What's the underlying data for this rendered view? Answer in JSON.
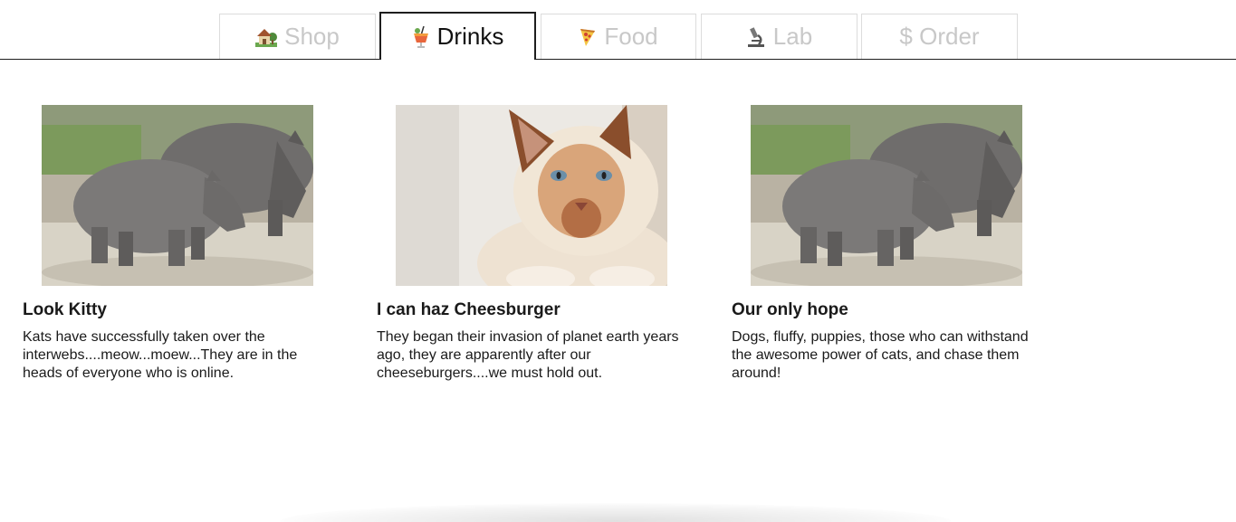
{
  "tabs": [
    {
      "label": "Shop",
      "icon": "house-icon",
      "active": false
    },
    {
      "label": "Drinks",
      "icon": "tropical-drink-icon",
      "active": true
    },
    {
      "label": "Food",
      "icon": "pizza-icon",
      "active": false
    },
    {
      "label": "Lab",
      "icon": "microscope-icon",
      "active": false
    },
    {
      "label": "$ Order",
      "icon": "",
      "active": false
    }
  ],
  "cards": [
    {
      "image": "rhino-photo",
      "title": "Look Kitty",
      "text": "Kats have successfully taken over the interwebs....meow...moew...They are in the heads of everyone who is online."
    },
    {
      "image": "cat-photo",
      "title": "I can haz Cheesburger",
      "text": "They began their invasion of planet earth years ago, they are apparently after our cheeseburgers....we must hold out."
    },
    {
      "image": "rhino-photo",
      "title": "Our only hope",
      "text": "Dogs, fluffy, puppies, those who can withstand the awesome power of cats, and chase them around!"
    }
  ],
  "colors": {
    "tab_active_text": "#111111",
    "tab_inactive_text": "#c8c8c8",
    "tab_border": "#dcdcdc",
    "baseline": "#1e1e1e"
  }
}
